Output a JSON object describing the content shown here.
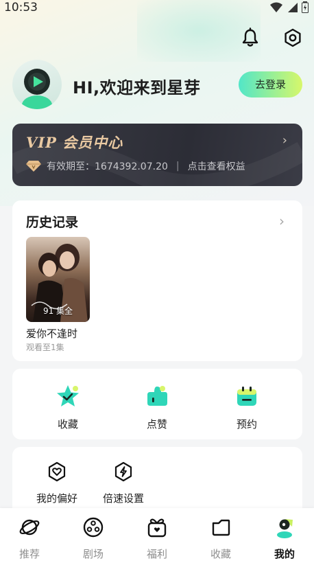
{
  "status_bar": {
    "time": "10:53"
  },
  "profile": {
    "greeting": "HI,欢迎来到星芽",
    "login_label": "去登录"
  },
  "vip": {
    "title": "VIP 会员中心",
    "validity_label": "有效期至：1674392.07.20",
    "separator": "|",
    "benefits_link": "点击查看权益"
  },
  "history": {
    "title": "历史记录",
    "items": [
      {
        "episodes_badge": "91 集全",
        "name": "爱你不逢时",
        "progress": "观看至1集"
      }
    ]
  },
  "actions": [
    {
      "label": "收藏",
      "icon": "star-icon"
    },
    {
      "label": "点赞",
      "icon": "thumbs-up-icon"
    },
    {
      "label": "预约",
      "icon": "calendar-icon"
    }
  ],
  "preferences": [
    {
      "label": "我的偏好",
      "icon": "heart-shield-icon"
    },
    {
      "label": "倍速设置",
      "icon": "speed-icon"
    }
  ],
  "tabbar": {
    "active": "我的",
    "tabs": [
      {
        "label": "推荐",
        "icon": "planet-icon"
      },
      {
        "label": "剧场",
        "icon": "film-reel-icon"
      },
      {
        "label": "福利",
        "icon": "gift-icon"
      },
      {
        "label": "收藏",
        "icon": "folder-icon"
      },
      {
        "label": "我的",
        "icon": "profile-icon"
      }
    ]
  },
  "colors": {
    "accent_start": "#52e6c8",
    "accent_end": "#d7f76a",
    "vip_gold": "#e9c9a2",
    "vip_bg": "#2c2d36"
  }
}
